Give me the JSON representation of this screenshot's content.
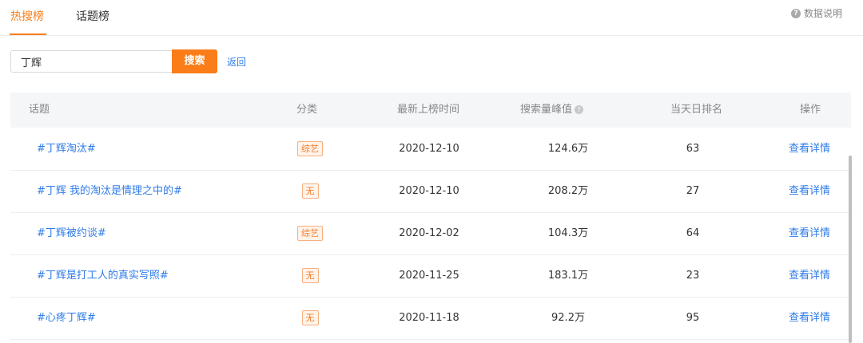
{
  "tabs": [
    {
      "label": "热搜榜",
      "active": true
    },
    {
      "label": "话题榜",
      "active": false
    }
  ],
  "help": {
    "label": "数据说明",
    "icon": "question-circle-icon"
  },
  "search": {
    "value": "丁辉",
    "button_label": "搜索",
    "back_label": "返回"
  },
  "table": {
    "headers": {
      "topic": "话题",
      "category": "分类",
      "latest_time": "最新上榜时间",
      "peak": "搜索量峰值",
      "rank": "当天日排名",
      "action": "操作"
    },
    "rows": [
      {
        "topic": "#丁辉淘汰#",
        "category": "综艺",
        "date": "2020-12-10",
        "peak": "124.6万",
        "rank": "63",
        "action": "查看详情"
      },
      {
        "topic": "#丁辉 我的淘汰是情理之中的#",
        "category": "无",
        "date": "2020-12-10",
        "peak": "208.2万",
        "rank": "27",
        "action": "查看详情"
      },
      {
        "topic": "#丁辉被约谈#",
        "category": "综艺",
        "date": "2020-12-02",
        "peak": "104.3万",
        "rank": "64",
        "action": "查看详情"
      },
      {
        "topic": "#丁辉是打工人的真实写照#",
        "category": "无",
        "date": "2020-11-25",
        "peak": "183.1万",
        "rank": "23",
        "action": "查看详情"
      },
      {
        "topic": "#心疼丁辉#",
        "category": "无",
        "date": "2020-11-18",
        "peak": "92.2万",
        "rank": "95",
        "action": "查看详情"
      }
    ]
  },
  "colors": {
    "accent": "#fa7d19",
    "link": "#2f7ce8",
    "badge_text": "#f47b22"
  }
}
